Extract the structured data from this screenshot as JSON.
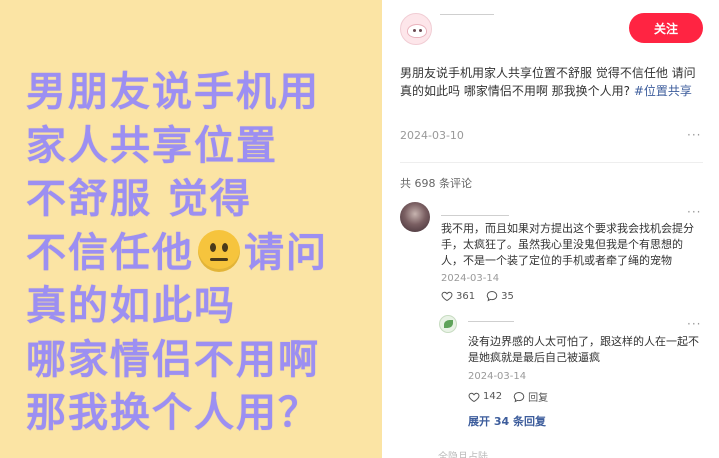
{
  "image_text": {
    "lines": [
      "男朋友说手机用",
      "家人共享位置",
      "不舒服 觉得",
      "不信任他",
      "请问",
      "真的如此吗",
      "哪家情侣不用啊",
      "那我换个人用？"
    ]
  },
  "post": {
    "follow_label": "关注",
    "body": "男朋友说手机用家人共享位置不舒服 觉得不信任他 请问真的如此吗 哪家情侣不用啊 那我换个人用?",
    "tag": "#位置共享",
    "date": "2024-03-10",
    "more": "···"
  },
  "comments": {
    "count_label": "共 698 条评论",
    "items": [
      {
        "text": "我不用，而且如果对方提出这个要求我会找机会提分手，太疯狂了。虽然我心里没鬼但我是个有思想的人，不是一个装了定位的手机或者牵了绳的宠物",
        "date": "2024-03-14",
        "likes": "361",
        "replies": "35",
        "more": "···"
      },
      {
        "text": "没有边界感的人太可怕了，跟这样的人在一起不是她疯就是最后自己被逼疯",
        "date": "2024-03-14",
        "likes": "142",
        "reply_label": "回复",
        "more": "···"
      }
    ],
    "expand_label": "展开 34 条回复",
    "bottom_partial": "全隐且占陆"
  },
  "colors": {
    "accent": "#ff2442",
    "link": "#3d5d9c",
    "image_bg": "#fbe4a4",
    "image_text": "#9c8ff2"
  },
  "icons": [
    "neutral-face-emoji",
    "heart-icon",
    "comment-bubble-icon",
    "more-icon"
  ]
}
